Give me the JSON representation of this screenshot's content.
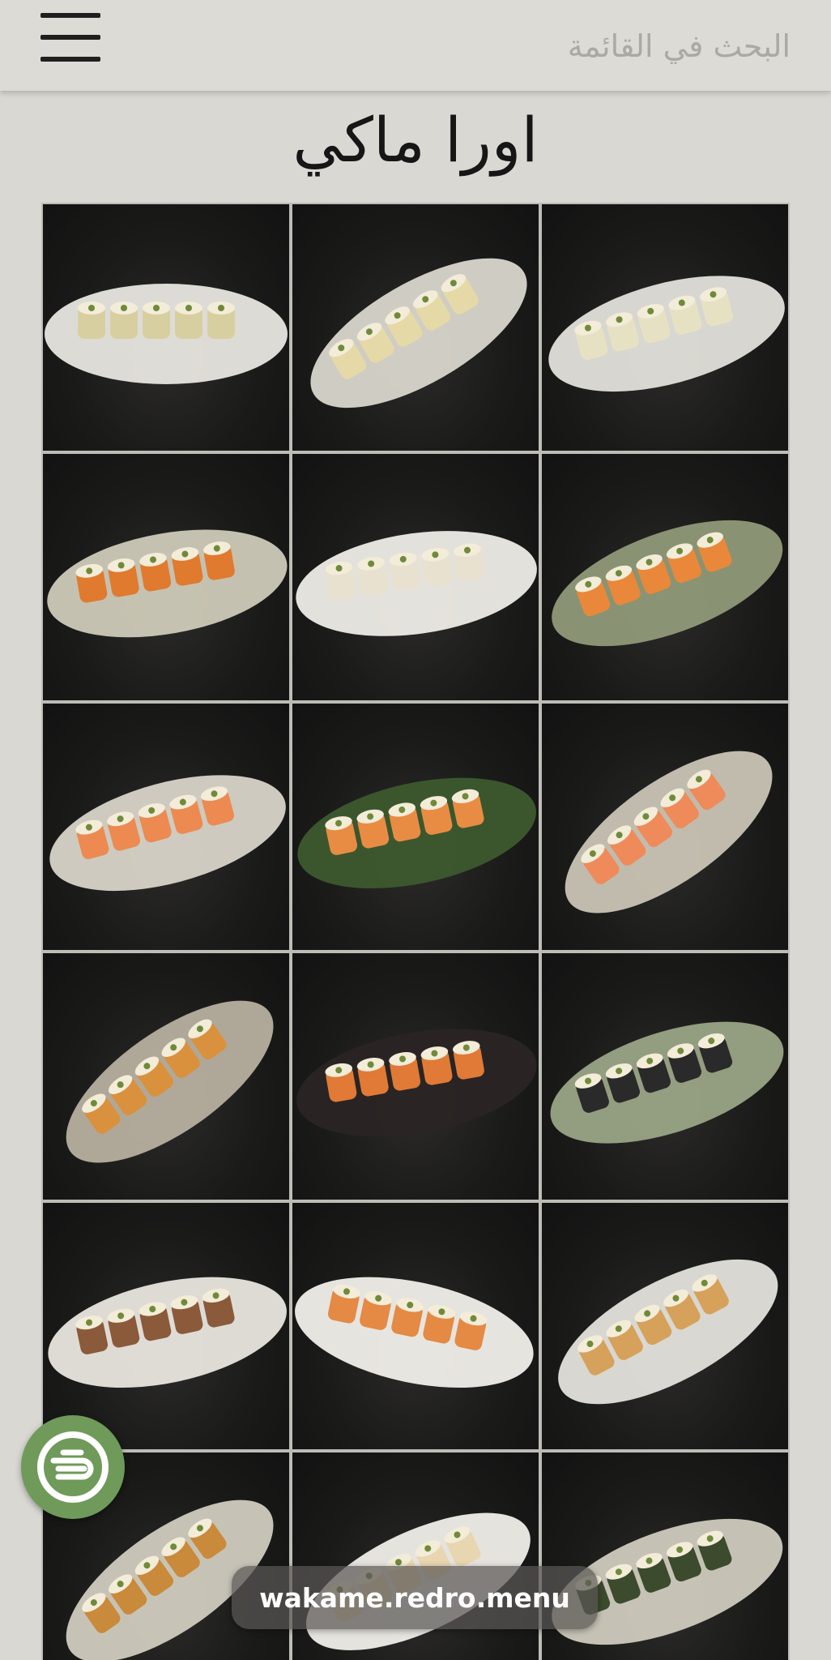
{
  "header": {
    "menu_icon": "hamburger-menu-icon",
    "search_placeholder": "البحث في القائمة"
  },
  "page_title": "اورا ماكي",
  "grid": {
    "rows": 6,
    "columns": 3,
    "tile_count": 18,
    "tiles_content": "sushi roll product photos"
  },
  "fab": {
    "icon": "redro-logo-icon",
    "color": "#6f9a5a"
  },
  "footer": {
    "domain": "wakame.redro.menu"
  },
  "colors": {
    "background": "#d9d8d3",
    "header_bg": "#dcdbd6",
    "accent_green": "#6f9a5a"
  }
}
